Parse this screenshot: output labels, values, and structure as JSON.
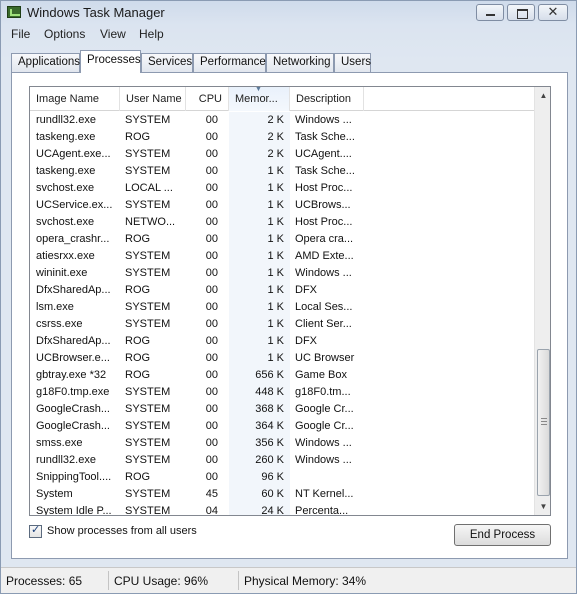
{
  "window": {
    "title": "Windows Task Manager"
  },
  "menu": [
    "File",
    "Options",
    "View",
    "Help"
  ],
  "tabs": [
    "Applications",
    "Processes",
    "Services",
    "Performance",
    "Networking",
    "Users"
  ],
  "active_tab": "Processes",
  "columns": [
    "Image Name",
    "User Name",
    "CPU",
    "Memor...",
    "Description"
  ],
  "processes": [
    {
      "name": "rundll32.exe",
      "user": "SYSTEM",
      "cpu": "00",
      "mem": "2 K",
      "desc": "Windows ..."
    },
    {
      "name": "taskeng.exe",
      "user": "ROG",
      "cpu": "00",
      "mem": "2 K",
      "desc": "Task Sche..."
    },
    {
      "name": "UCAgent.exe...",
      "user": "SYSTEM",
      "cpu": "00",
      "mem": "2 K",
      "desc": "UCAgent...."
    },
    {
      "name": "taskeng.exe",
      "user": "SYSTEM",
      "cpu": "00",
      "mem": "1 K",
      "desc": "Task Sche..."
    },
    {
      "name": "svchost.exe",
      "user": "LOCAL ...",
      "cpu": "00",
      "mem": "1 K",
      "desc": "Host Proc..."
    },
    {
      "name": "UCService.ex...",
      "user": "SYSTEM",
      "cpu": "00",
      "mem": "1 K",
      "desc": "UCBrows..."
    },
    {
      "name": "svchost.exe",
      "user": "NETWO...",
      "cpu": "00",
      "mem": "1 K",
      "desc": "Host Proc..."
    },
    {
      "name": "opera_crashr...",
      "user": "ROG",
      "cpu": "00",
      "mem": "1 K",
      "desc": "Opera cra..."
    },
    {
      "name": "atiesrxx.exe",
      "user": "SYSTEM",
      "cpu": "00",
      "mem": "1 K",
      "desc": "AMD Exte..."
    },
    {
      "name": "wininit.exe",
      "user": "SYSTEM",
      "cpu": "00",
      "mem": "1 K",
      "desc": "Windows ..."
    },
    {
      "name": "DfxSharedAp...",
      "user": "ROG",
      "cpu": "00",
      "mem": "1 K",
      "desc": "DFX"
    },
    {
      "name": "lsm.exe",
      "user": "SYSTEM",
      "cpu": "00",
      "mem": "1 K",
      "desc": "Local Ses..."
    },
    {
      "name": "csrss.exe",
      "user": "SYSTEM",
      "cpu": "00",
      "mem": "1 K",
      "desc": "Client Ser..."
    },
    {
      "name": "DfxSharedAp...",
      "user": "ROG",
      "cpu": "00",
      "mem": "1 K",
      "desc": "DFX"
    },
    {
      "name": "UCBrowser.e...",
      "user": "ROG",
      "cpu": "00",
      "mem": "1 K",
      "desc": "UC Browser"
    },
    {
      "name": "gbtray.exe *32",
      "user": "ROG",
      "cpu": "00",
      "mem": "656 K",
      "desc": "Game Box"
    },
    {
      "name": "g18F0.tmp.exe",
      "user": "SYSTEM",
      "cpu": "00",
      "mem": "448 K",
      "desc": "g18F0.tm..."
    },
    {
      "name": "GoogleCrash...",
      "user": "SYSTEM",
      "cpu": "00",
      "mem": "368 K",
      "desc": "Google Cr..."
    },
    {
      "name": "GoogleCrash...",
      "user": "SYSTEM",
      "cpu": "00",
      "mem": "364 K",
      "desc": "Google Cr..."
    },
    {
      "name": "smss.exe",
      "user": "SYSTEM",
      "cpu": "00",
      "mem": "356 K",
      "desc": "Windows ..."
    },
    {
      "name": "rundll32.exe",
      "user": "SYSTEM",
      "cpu": "00",
      "mem": "260 K",
      "desc": "Windows ..."
    },
    {
      "name": "SnippingTool....",
      "user": "ROG",
      "cpu": "00",
      "mem": "96 K",
      "desc": ""
    },
    {
      "name": "System",
      "user": "SYSTEM",
      "cpu": "45",
      "mem": "60 K",
      "desc": "NT Kernel..."
    },
    {
      "name": "System Idle P...",
      "user": "SYSTEM",
      "cpu": "04",
      "mem": "24 K",
      "desc": "Percenta..."
    }
  ],
  "show_all_users": {
    "label": "Show processes from all users",
    "checked": true
  },
  "end_process_label": "End Process",
  "status": {
    "processes": "Processes: 65",
    "cpu": "CPU Usage: 96%",
    "memory": "Physical Memory: 34%"
  },
  "icons": {
    "app": "task-manager-icon",
    "minimize": "minimize-icon",
    "maximize": "maximize-icon",
    "close": "close-icon",
    "scroll_up": "scroll-up-icon",
    "scroll_down": "scroll-down-icon",
    "sort": "sort-descending-icon"
  },
  "colors": {
    "title_bg": "#cfdbeb",
    "panel": "#ffffff",
    "sorted_column": "#f2f6fb"
  }
}
